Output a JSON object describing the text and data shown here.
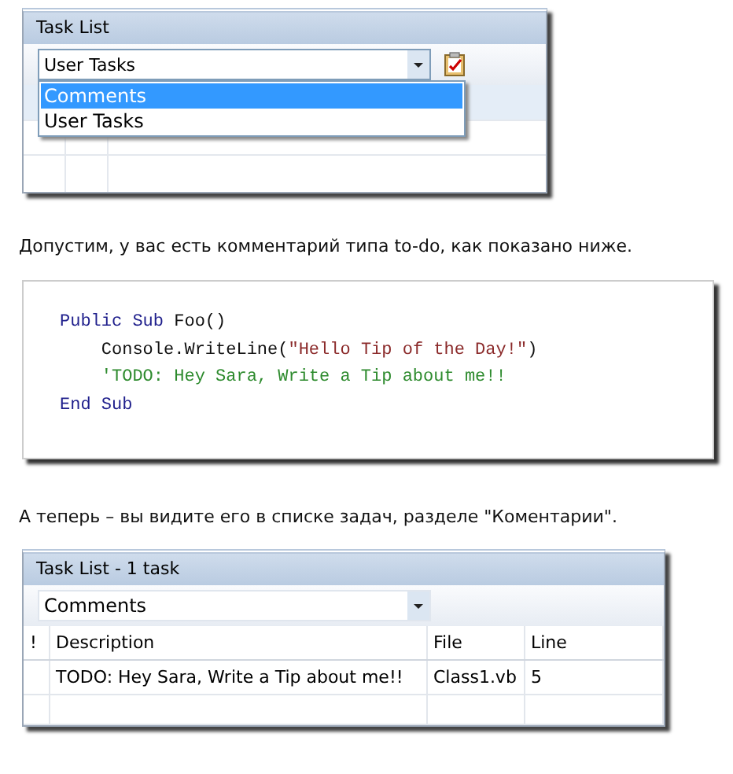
{
  "task_list_filter": {
    "title": "Task List",
    "filter": {
      "value": "User Tasks",
      "expanded": true
    },
    "options": [
      {
        "label": "Comments",
        "selected": true
      },
      {
        "label": "User Tasks",
        "selected": false
      }
    ]
  },
  "paragraph_1": "Допустим, у вас есть комментарий типа to-do, как показано ниже.",
  "code": {
    "lines": [
      {
        "tokens": [
          {
            "kind": "keyword",
            "text": "Public Sub"
          },
          {
            "kind": "plain",
            "text": " Foo()"
          }
        ]
      },
      {
        "tokens": [
          {
            "kind": "plain",
            "text": "    Console.WriteLine("
          },
          {
            "kind": "string",
            "text": "\"Hello Tip of the Day!\""
          },
          {
            "kind": "plain",
            "text": ")"
          }
        ]
      },
      {
        "tokens": [
          {
            "kind": "comment",
            "text": "    'TODO: Hey Sara, Write a Tip about me!!"
          }
        ]
      },
      {
        "tokens": [
          {
            "kind": "keyword",
            "text": "End Sub"
          }
        ]
      }
    ]
  },
  "paragraph_2": "А теперь – вы видите его в списке задач, разделе \"Коментарии\".",
  "task_list": {
    "title": "Task List - 1 task",
    "filter": {
      "value": "Comments"
    },
    "columns": [
      "!",
      "Description",
      "File",
      "Line"
    ],
    "rows": [
      {
        "description": "TODO: Hey Sara, Write a Tip about me!!",
        "file": "Class1.vb",
        "line": "5"
      }
    ]
  }
}
